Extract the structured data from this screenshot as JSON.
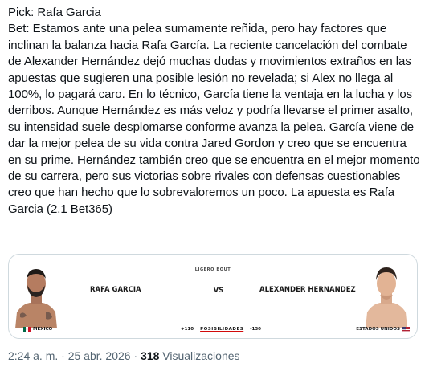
{
  "tweet": {
    "lines": [
      "Pick: Rafa Garcia",
      "Bet: Estamos ante una pelea sumamente reñida, pero hay factores que inclinan la balanza hacia Rafa García. La reciente cancelación del combate de Alexander Hernández dejó muchas dudas y movimientos extraños en las apuestas que sugieren una posible lesión no revelada; si Alex no llega al 100%, lo pagará caro. En lo técnico, García tiene la ventaja en la lucha y los derribos. Aunque Hernández es más veloz y podría llevarse el primer asalto, su intensidad suele desplomarse conforme avanza la pelea. García viene de dar la mejor pelea de su vida contra Jared Gordon y creo que se encuentra en su prime. Hernández también creo que se encuentra en el mejor momento de su carrera, pero sus victorias sobre rivales con defensas cuestionables creo que han hecho que lo sobrevaloremos un poco. La apuesta es Rafa Garcia (2.1 Bet365)"
    ]
  },
  "card": {
    "weight_class": "LIGERO BOUT",
    "fighter_left": {
      "name": "RAFA GARCIA",
      "country": "MÉXICO",
      "odds": "+110",
      "flag_colors": [
        "#006847",
        "#ffffff",
        "#ce1126"
      ]
    },
    "vs_label": "VS",
    "odds_link": "POSIBILIDADES",
    "fighter_right": {
      "name": "ALEXANDER HERNANDEZ",
      "country": "ESTADOS UNIDOS",
      "odds": "-130"
    }
  },
  "meta": {
    "time": "2:24 a. m.",
    "separator": "·",
    "date": "25 abr. 2026",
    "views_count": "318",
    "views_label": "Visualizaciones"
  }
}
